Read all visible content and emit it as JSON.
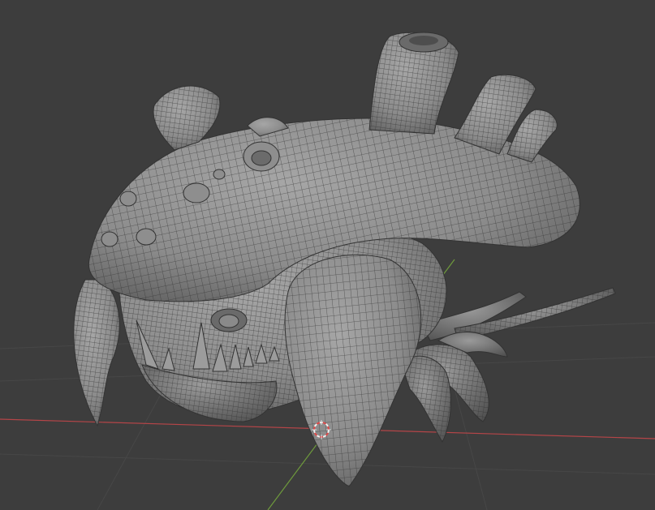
{
  "viewport": {
    "background": "#3d3d3d",
    "grid_color": "#474747",
    "x_axis_color": "#b54548",
    "y_axis_color": "#6e9a3c"
  },
  "model": {
    "base_color": "#8f8f8f",
    "shadow_color": "#5c5c5c",
    "wire_color": "#2f2f2f"
  },
  "cursor_3d": {
    "ring_colors": [
      "#e04848",
      "#f0f0f0"
    ]
  }
}
